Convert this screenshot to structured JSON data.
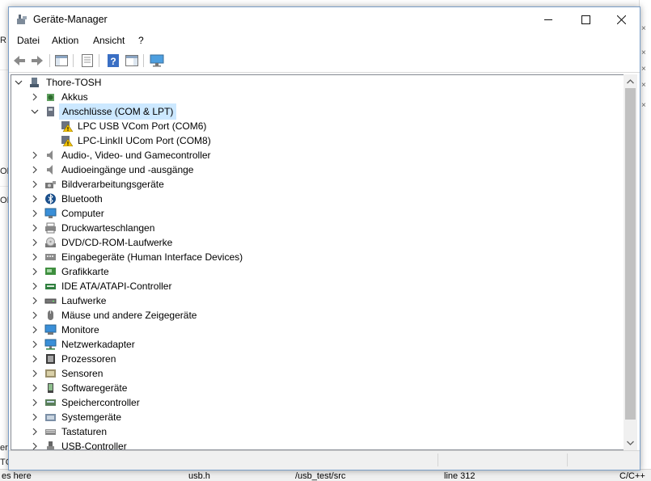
{
  "background": {
    "left_fragments": [
      "R",
      "OR",
      "OI",
      "erc",
      "TC"
    ],
    "status_cells": [
      "es here",
      "usb.h",
      "/usb_test/src",
      "line 312",
      "C/C++"
    ]
  },
  "window": {
    "title": "Geräte-Manager",
    "controls": {
      "minimize": "—",
      "maximize": "☐",
      "close": "✕"
    }
  },
  "menu": [
    "Datei",
    "Aktion",
    "Ansicht",
    "?"
  ],
  "toolbar": {
    "buttons": [
      "back",
      "forward",
      "show-hide-console-tree",
      "properties",
      "help",
      "action-pane",
      "monitor"
    ]
  },
  "tree": {
    "root": "Thore-TOSH",
    "categories": [
      {
        "label": "Akkus",
        "icon": "battery-icon",
        "expanded": false
      },
      {
        "label": "Anschlüsse (COM & LPT)",
        "icon": "port-icon",
        "expanded": true,
        "selected": true,
        "children": [
          {
            "label": "LPC USB VCom Port (COM6)",
            "icon": "warning-port-icon"
          },
          {
            "label": "LPC-LinkII UCom Port (COM8)",
            "icon": "warning-port-icon"
          }
        ]
      },
      {
        "label": "Audio-, Video- und Gamecontroller",
        "icon": "speaker-icon",
        "expanded": false
      },
      {
        "label": "Audioeingänge und -ausgänge",
        "icon": "speaker-icon",
        "expanded": false
      },
      {
        "label": "Bildverarbeitungsgeräte",
        "icon": "camera-icon",
        "expanded": false
      },
      {
        "label": "Bluetooth",
        "icon": "bluetooth-icon",
        "expanded": false
      },
      {
        "label": "Computer",
        "icon": "computer-icon",
        "expanded": false
      },
      {
        "label": "Druckwarteschlangen",
        "icon": "printer-icon",
        "expanded": false
      },
      {
        "label": "DVD/CD-ROM-Laufwerke",
        "icon": "disc-icon",
        "expanded": false
      },
      {
        "label": "Eingabegeräte (Human Interface Devices)",
        "icon": "hid-icon",
        "expanded": false
      },
      {
        "label": "Grafikkarte",
        "icon": "display-adapter-icon",
        "expanded": false
      },
      {
        "label": "IDE ATA/ATAPI-Controller",
        "icon": "ide-icon",
        "expanded": false
      },
      {
        "label": "Laufwerke",
        "icon": "drive-icon",
        "expanded": false
      },
      {
        "label": "Mäuse und andere Zeigegeräte",
        "icon": "mouse-icon",
        "expanded": false
      },
      {
        "label": "Monitore",
        "icon": "monitor-icon",
        "expanded": false
      },
      {
        "label": "Netzwerkadapter",
        "icon": "network-icon",
        "expanded": false
      },
      {
        "label": "Prozessoren",
        "icon": "cpu-icon",
        "expanded": false
      },
      {
        "label": "Sensoren",
        "icon": "sensor-icon",
        "expanded": false
      },
      {
        "label": "Softwaregeräte",
        "icon": "software-device-icon",
        "expanded": false
      },
      {
        "label": "Speichercontroller",
        "icon": "storage-controller-icon",
        "expanded": false
      },
      {
        "label": "Systemgeräte",
        "icon": "system-folder-icon",
        "expanded": false
      },
      {
        "label": "Tastaturen",
        "icon": "keyboard-icon",
        "expanded": false
      },
      {
        "label": "USB-Controller",
        "icon": "usb-icon",
        "expanded": false
      }
    ]
  },
  "colors": {
    "selection": "#cce8ff",
    "accent_blue": "#3a7bd5",
    "warning": "#f2c200"
  }
}
